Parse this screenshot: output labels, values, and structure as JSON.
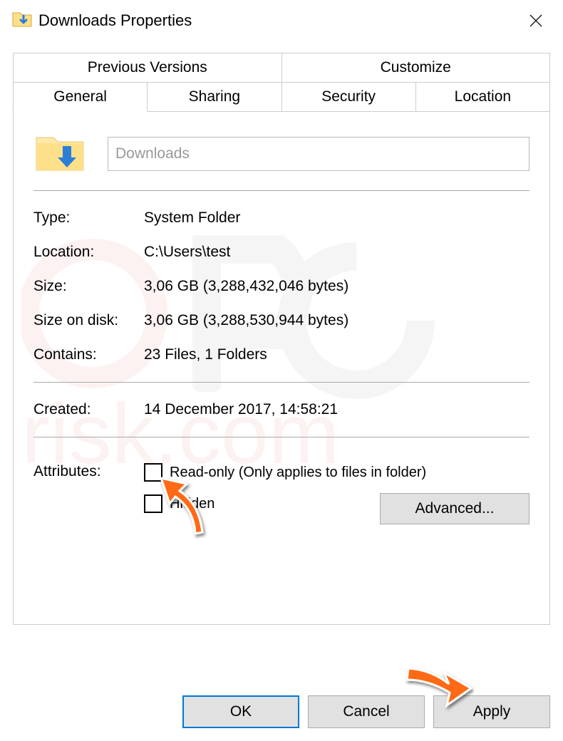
{
  "titlebar": {
    "title": "Downloads Properties"
  },
  "tabs": {
    "row1": [
      {
        "label": "Previous Versions"
      },
      {
        "label": "Customize"
      }
    ],
    "row2": [
      {
        "label": "General",
        "active": true
      },
      {
        "label": "Sharing"
      },
      {
        "label": "Security"
      },
      {
        "label": "Location"
      }
    ]
  },
  "folder": {
    "name": "Downloads"
  },
  "props": {
    "type_label": "Type:",
    "type": "System Folder",
    "loc_label": "Location:",
    "location": "C:\\Users\\test",
    "size_label": "Size:",
    "size": "3,06 GB (3,288,432,046 bytes)",
    "disk_label": "Size on disk:",
    "size_on_disk": "3,06 GB (3,288,530,944 bytes)",
    "contains_label": "Contains:",
    "contains": "23 Files, 1 Folders",
    "created_label": "Created:",
    "created": "14 December 2017, 14:58:21"
  },
  "attrs": {
    "label": "Attributes:",
    "readonly": "Read-only (Only applies to files in folder)",
    "hidden": "Hidden",
    "advanced": "Advanced..."
  },
  "buttons": {
    "ok": "OK",
    "cancel": "Cancel",
    "apply": "Apply"
  }
}
